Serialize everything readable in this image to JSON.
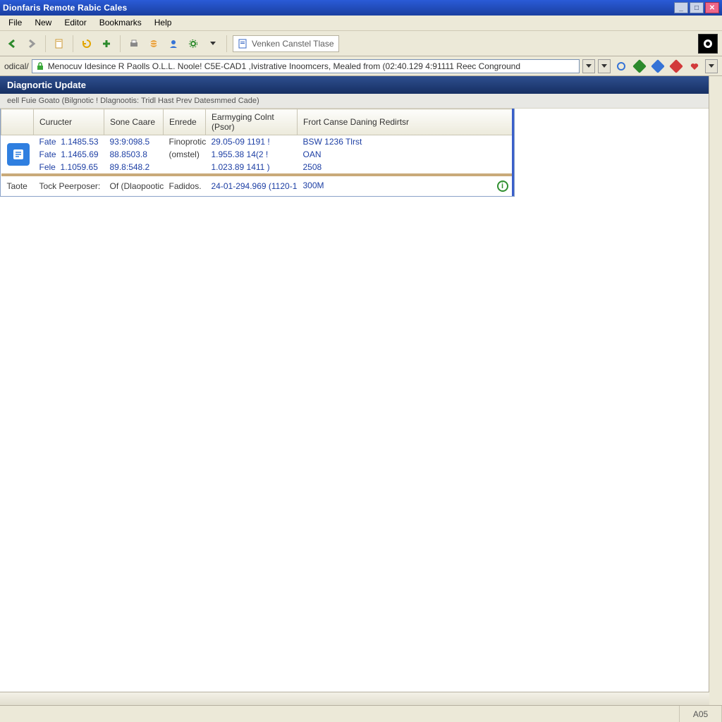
{
  "window": {
    "title": "Dionfaris Remote Rabic Cales",
    "buttons": {
      "min": "_",
      "max": "□",
      "close": "✕"
    }
  },
  "menu": [
    {
      "key": "file",
      "label": "File",
      "ul": "F"
    },
    {
      "key": "new",
      "label": "New",
      "ul": "N"
    },
    {
      "key": "editor",
      "label": "Editor",
      "ul": "E"
    },
    {
      "key": "bookmarks",
      "label": "Bookmarks",
      "ul": "B"
    },
    {
      "key": "help",
      "label": "Help",
      "ul": "H"
    }
  ],
  "toolbar": {
    "chip_label": "Venken Canstel Tlase"
  },
  "address": {
    "label": "odical/",
    "value": "Menocuv Idesince R Paolls O.L.L. Noole! C5E-CAD1 ,Ivistrative Inoomcers, Mealed from (02:40.129 4:91111 Reec Conground"
  },
  "icons": {
    "back": "back-icon",
    "fwd": "forward-icon",
    "stop": "stop-icon",
    "reload": "reload-icon",
    "home": "home-icon",
    "plus": "plus-icon",
    "star": "star-icon",
    "print": "print-icon",
    "globe": "globe-icon",
    "user": "user-icon",
    "gear": "gear-icon",
    "page": "page-icon",
    "tick": "tick-icon",
    "shield": "shield-icon",
    "db": "database-icon",
    "play": "play-icon",
    "diamond_g": "diamond-green-icon",
    "diamond_b": "diamond-blue-icon",
    "diamond_r": "diamond-red-icon",
    "heart": "heart-icon"
  },
  "section": {
    "title": "Diagnortic Update",
    "subcaption": "eell Fuie Goato (Bilgnotic ! Dlagnootis:  Tridl Hast Prev Datesmmed Cade)"
  },
  "grid": {
    "columns": [
      "",
      "Curucter",
      "Sone Caare",
      "Enrede",
      "Earmyging Colnt (Psor)",
      "Frort Canse Daning Redirtsr"
    ],
    "rows": [
      {
        "c0": "Fate",
        "c1": "1.1485.53",
        "c2": "93:9:098.5",
        "c3": "Finoprotic",
        "c4": "29.05-09 1191 !",
        "c5": "BSW 1236 Tlrst"
      },
      {
        "c0": "Fate",
        "c1": "1.1465.69",
        "c2": "88.8503.8",
        "c3": "(omstel)",
        "c4": "1.955.38 14(2 !",
        "c5": "OAN"
      },
      {
        "c0": "Fele",
        "c1": "1.1059.65",
        "c2": "89.8:548.2",
        "c3": "",
        "c4": "1.023.89 1411 )",
        "c5": "2508"
      }
    ],
    "footer": {
      "c0": "Taote",
      "c1": "Tock Peerposer:",
      "c2": "Of (Dlaopootic",
      "c3": "Fadidos.",
      "c4": "24-01-294.969  (1120-1",
      "c5": "300M"
    }
  },
  "status": {
    "right": "A05"
  }
}
